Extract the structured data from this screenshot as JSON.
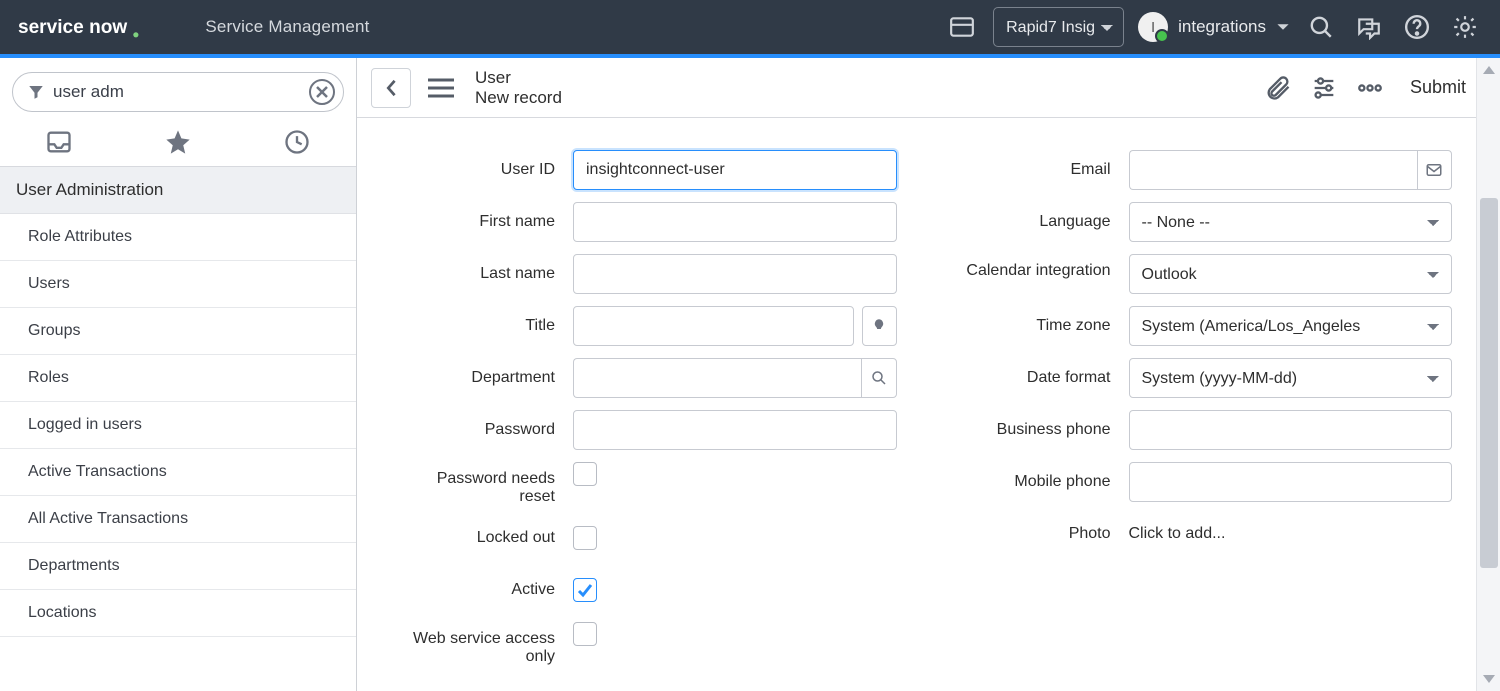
{
  "header": {
    "app_name": "Service Management",
    "role_select": "Rapid7 Insig",
    "avatar_initial": "I",
    "user_name": "integrations"
  },
  "nav": {
    "search_value": "user adm",
    "section": "User Administration",
    "items": [
      "Role Attributes",
      "Users",
      "Groups",
      "Roles",
      "Logged in users",
      "Active Transactions",
      "All Active Transactions",
      "Departments",
      "Locations"
    ]
  },
  "record": {
    "title": "User",
    "subtitle": "New record",
    "submit": "Submit"
  },
  "form": {
    "left": {
      "user_id": {
        "label": "User ID",
        "value": "insightconnect-user"
      },
      "first_name": {
        "label": "First name",
        "value": ""
      },
      "last_name": {
        "label": "Last name",
        "value": ""
      },
      "title": {
        "label": "Title",
        "value": ""
      },
      "department": {
        "label": "Department",
        "value": ""
      },
      "password": {
        "label": "Password",
        "value": ""
      },
      "password_needs_reset": {
        "label": "Password needs reset",
        "checked": false
      },
      "locked_out": {
        "label": "Locked out",
        "checked": false
      },
      "active": {
        "label": "Active",
        "checked": true
      },
      "web_service_access_only": {
        "label": "Web service access only",
        "checked": false
      }
    },
    "right": {
      "email": {
        "label": "Email",
        "value": ""
      },
      "language": {
        "label": "Language",
        "value": "-- None --"
      },
      "calendar_integration": {
        "label": "Calendar integration",
        "value": "Outlook"
      },
      "time_zone": {
        "label": "Time zone",
        "value": "System (America/Los_Angeles"
      },
      "date_format": {
        "label": "Date format",
        "value": "System (yyyy-MM-dd)"
      },
      "business_phone": {
        "label": "Business phone",
        "value": ""
      },
      "mobile_phone": {
        "label": "Mobile phone",
        "value": ""
      },
      "photo": {
        "label": "Photo",
        "placeholder": "Click to add..."
      }
    }
  }
}
